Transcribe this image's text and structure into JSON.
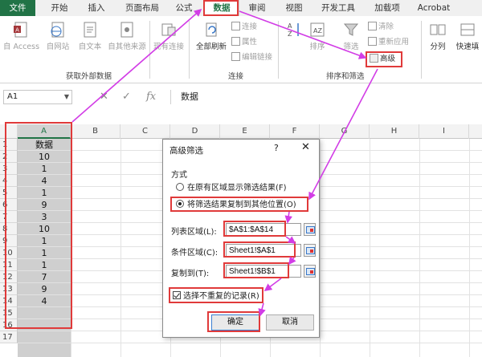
{
  "menu": {
    "tabs": [
      "文件",
      "开始",
      "插入",
      "页面布局",
      "公式",
      "数据",
      "审阅",
      "视图",
      "开发工具",
      "加载项",
      "Acrobat"
    ],
    "active_tab": "数据"
  },
  "ribbon": {
    "external": {
      "from_access": "自 Access",
      "from_web": "自网站",
      "from_text": "自文本",
      "from_other": "自其他来源",
      "existing_conn": "现有连接",
      "group_label": "获取外部数据"
    },
    "connections": {
      "refresh_all": "全部刷新",
      "connections": "连接",
      "properties": "属性",
      "edit_links": "编辑链接",
      "group_label": "连接"
    },
    "sort_filter": {
      "sort": "排序",
      "filter": "筛选",
      "clear": "清除",
      "reapply": "重新应用",
      "advanced": "高级",
      "group_label": "排序和筛选"
    },
    "tools": {
      "split": "分列",
      "flash_fill": "快速填"
    }
  },
  "formula_bar": {
    "name_box": "A1",
    "fx": "fx",
    "formula": "数据"
  },
  "sheet": {
    "columns": [
      "A",
      "B",
      "C",
      "D",
      "E",
      "F",
      "G",
      "H",
      "I"
    ],
    "rows": [
      "1",
      "2",
      "3",
      "4",
      "5",
      "6",
      "7",
      "8",
      "9",
      "10",
      "11",
      "12",
      "13",
      "14",
      "15",
      "16",
      "17"
    ],
    "column_a": [
      "数据",
      "10",
      "1",
      "4",
      "1",
      "9",
      "3",
      "10",
      "1",
      "1",
      "1",
      "7",
      "9",
      "4"
    ]
  },
  "dialog": {
    "title": "高级筛选",
    "help": "?",
    "close": "✕",
    "method_label": "方式",
    "option_in_place": "在原有区域显示筛选结果(F)",
    "option_copy": "将筛选结果复制到其他位置(O)",
    "list_range_label": "列表区域(L):",
    "list_range_value": "$A$1:$A$14",
    "criteria_range_label": "条件区域(C):",
    "criteria_range_value": "Sheet1!$A$1",
    "copy_to_label": "复制到(T):",
    "copy_to_value": "Sheet1!$B$1",
    "unique_label": "选择不重复的记录(R)",
    "ok": "确定",
    "cancel": "取消"
  },
  "colors": {
    "excel_green": "#217346",
    "annotation_red": "#e03a3a",
    "annotation_magenta": "#d23de6"
  }
}
